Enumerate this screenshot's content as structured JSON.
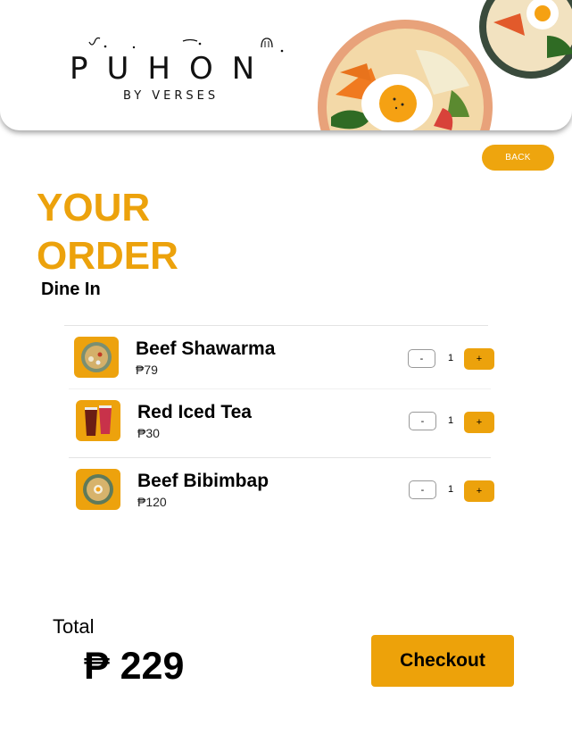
{
  "brand": {
    "name": "PUHON",
    "tagline": "BY VERSES"
  },
  "header": {
    "back_label": "BACK"
  },
  "page": {
    "title_line1": "YOUR",
    "title_line2": "ORDER",
    "order_type": "Dine In"
  },
  "order": {
    "items": [
      {
        "name": "Beef Shawarma",
        "price": "₱79",
        "quantity": "1",
        "minus_label": "-",
        "plus_label": "+",
        "icon": "beef-shawarma-icon"
      },
      {
        "name": "Red Iced Tea",
        "price": "₱30",
        "quantity": "1",
        "minus_label": "-",
        "plus_label": "+",
        "icon": "red-iced-tea-icon"
      },
      {
        "name": "Beef Bibimbap",
        "price": "₱120",
        "quantity": "1",
        "minus_label": "-",
        "plus_label": "+",
        "icon": "beef-bibimbap-icon"
      }
    ]
  },
  "summary": {
    "total_label": "Total",
    "total_value": "₱ 229",
    "checkout_label": "Checkout"
  },
  "colors": {
    "accent": "#eca20c",
    "title": "#eca20c",
    "background": "#ffffff",
    "text": "#000000"
  }
}
